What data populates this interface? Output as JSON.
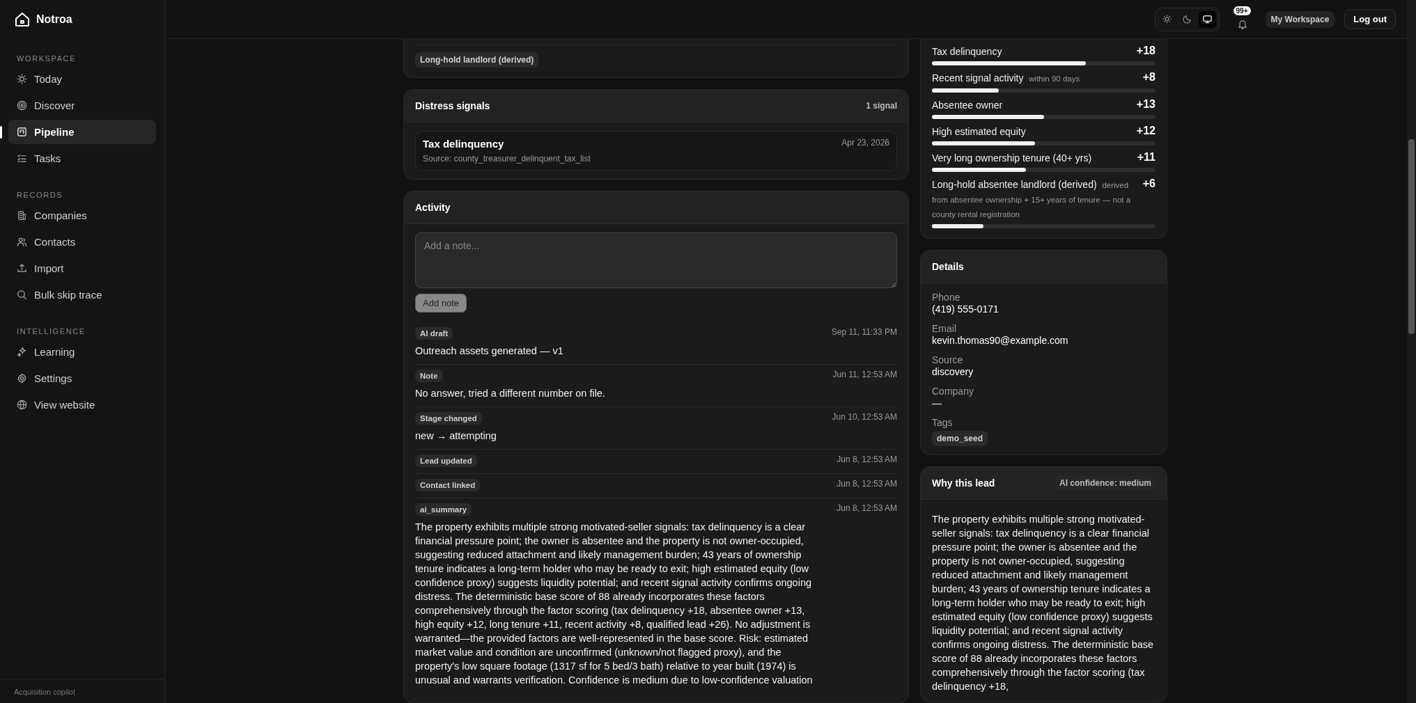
{
  "app": {
    "name": "Notroa",
    "footer": "Acquisition copilot"
  },
  "sidebar": {
    "sections": [
      {
        "title": "WORKSPACE",
        "items": [
          {
            "label": "Today",
            "selected": false
          },
          {
            "label": "Discover",
            "selected": false
          },
          {
            "label": "Pipeline",
            "selected": true
          },
          {
            "label": "Tasks",
            "selected": false
          }
        ]
      },
      {
        "title": "RECORDS",
        "items": [
          {
            "label": "Companies",
            "selected": false
          },
          {
            "label": "Contacts",
            "selected": false
          },
          {
            "label": "Import",
            "selected": false
          },
          {
            "label": "Bulk skip trace",
            "selected": false
          }
        ]
      },
      {
        "title": "INTELLIGENCE",
        "items": [
          {
            "label": "Learning",
            "selected": false
          },
          {
            "label": "Settings",
            "selected": false
          },
          {
            "label": "View website",
            "selected": false
          }
        ]
      }
    ]
  },
  "topbar": {
    "theme_options": [
      {
        "kind": "light",
        "selected": false
      },
      {
        "kind": "dark",
        "selected": false
      },
      {
        "kind": "system",
        "selected": true
      }
    ],
    "notification_count": "99+",
    "workspace": "My Workspace",
    "logout": "Log out"
  },
  "tags_card": {
    "tags": [
      "Long-hold landlord (derived)"
    ]
  },
  "distress_signals": {
    "title": "Distress signals",
    "count": "1 signal",
    "items": [
      {
        "name": "Tax delinquency",
        "source": "Source: county_treasurer_delinquent_tax_list",
        "date": "Apr 23, 2026"
      }
    ]
  },
  "activity": {
    "title": "Activity",
    "placeholder": "Add a note...",
    "add_button": "Add note",
    "entries": [
      {
        "type": "AI draft",
        "date": "Sep 11, 11:33 PM",
        "text": "Outreach assets generated — v1"
      },
      {
        "type": "Note",
        "date": "Jun 11, 12:53 AM",
        "text": "No answer, tried a different number on file."
      },
      {
        "type": "Stage changed",
        "date": "Jun 10, 12:53 AM",
        "text": "new → attempting"
      },
      {
        "type": "Lead updated",
        "date": "Jun 8, 12:53 AM"
      },
      {
        "type": "Contact linked",
        "date": "Jun 8, 12:53 AM"
      },
      {
        "type": "ai_summary",
        "date": "Jun 8, 12:53 AM",
        "text": "The property exhibits multiple strong motivated-seller signals: tax delinquency is a clear financial pressure point; the owner is absentee and the property is not owner-occupied, suggesting reduced attachment and likely management burden; 43 years of ownership tenure indicates a long-term holder who may be ready to exit; high estimated equity (low confidence proxy) suggests liquidity potential; and recent signal activity confirms ongoing distress. The deterministic base score of 88 already incorporates these factors comprehensively through the factor scoring (tax delinquency +18, absentee owner +13, high equity +12, long tenure +11, recent activity +8, qualified lead +26). No adjustment is warranted—the provided factors are well-represented in the base score. Risk: estimated market value and condition are unconfirmed (unknown/not flagged proxy), and the property's low square footage (1317 sf for 5 bed/3 bath) relative to year built (1974) is unusual and warrants verification. Confidence is medium due to low-confidence valuation"
      }
    ]
  },
  "score_factors": [
    {
      "label": "Tax delinquency",
      "points": "+18",
      "level": 0.69
    },
    {
      "label": "Recent signal activity",
      "note": "within 90 days",
      "points": "+8",
      "level": 0.3
    },
    {
      "label": "Absentee owner",
      "points": "+13",
      "level": 0.5
    },
    {
      "label": "High estimated equity",
      "points": "+12",
      "level": 0.46
    },
    {
      "label": "Very long ownership tenure (40+ yrs)",
      "points": "+11",
      "level": 0.42
    },
    {
      "label": "Long-hold absentee landlord (derived)",
      "note": "derived from absentee ownership + 15+ years of tenure — not a county rental registration",
      "points": "+6",
      "level": 0.23
    }
  ],
  "details": {
    "title": "Details",
    "fields": [
      {
        "label": "Phone",
        "value": "(419) 555-0171"
      },
      {
        "label": "Email",
        "value": "kevin.thomas90@example.com"
      },
      {
        "label": "Source",
        "value": "discovery"
      },
      {
        "label": "Company",
        "value": "—"
      }
    ],
    "tags_label": "Tags",
    "tags": [
      "demo_seed"
    ]
  },
  "why_this_lead": {
    "title": "Why this lead",
    "confidence": "AI confidence: medium",
    "text": "The property exhibits multiple strong motivated-seller signals: tax delinquency is a clear financial pressure point; the owner is absentee and the property is not owner-occupied, suggesting reduced attachment and likely management burden; 43 years of ownership tenure indicates a long-term holder who may be ready to exit; high estimated equity (low confidence proxy) suggests liquidity potential; and recent signal activity confirms ongoing distress. The deterministic base score of 88 already incorporates these factors comprehensively through the factor scoring (tax delinquency +18,"
  }
}
